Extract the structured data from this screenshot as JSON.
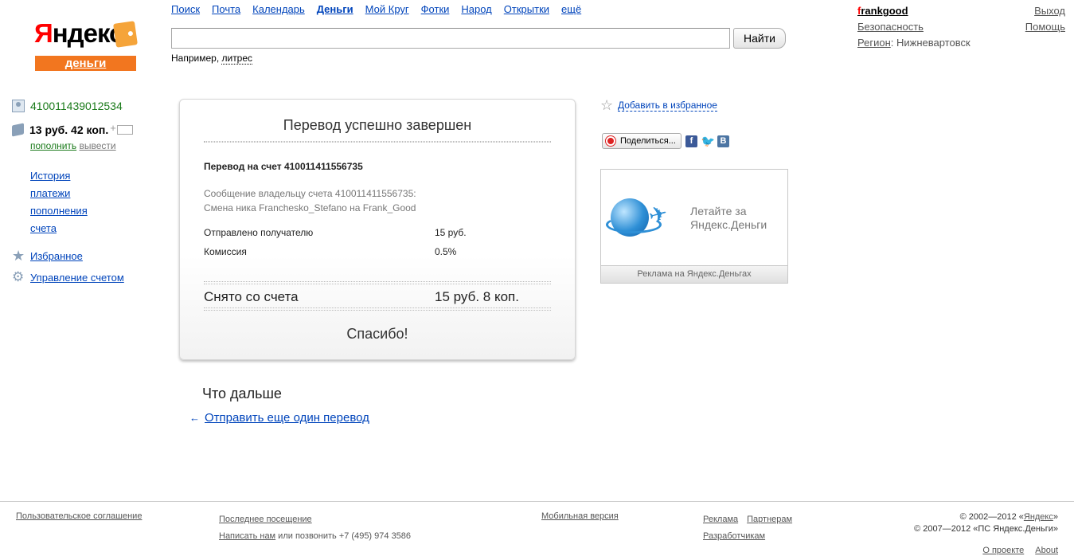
{
  "logo": {
    "word_first": "Я",
    "word_rest": "ндекс",
    "service": "деньги"
  },
  "topnav": {
    "items": [
      "Поиск",
      "Почта",
      "Календарь",
      "Деньги",
      "Мой Круг",
      "Фотки",
      "Народ",
      "Открытки",
      "ещё"
    ],
    "active": "Деньги"
  },
  "search": {
    "value": "",
    "button": "Найти",
    "example_prefix": "Например, ",
    "example_link": "литрес"
  },
  "user": {
    "name_first": "f",
    "name_rest": "rankgood",
    "security": "Безопасность",
    "region_label": "Регион",
    "region_value": ": Нижневартовск",
    "logout": "Выход",
    "help": "Помощь"
  },
  "sidebar": {
    "account_number": "410011439012534",
    "balance": "13 руб. 42 коп.",
    "topup": "пополнить",
    "withdraw": "вывести",
    "menu": [
      "История",
      "платежи",
      "пополнения",
      "счета"
    ],
    "favorites": "Избранное",
    "manage": "Управление счетом"
  },
  "receipt": {
    "title": "Перевод успешно завершен",
    "to": "Перевод на счет 410011411556735",
    "message_line1": "Сообщение владельцу счета 410011411556735:",
    "message_line2": "Смена ника Franchesko_Stefano на Frank_Good",
    "sent_label": "Отправлено получателю",
    "sent_value": "15 руб.",
    "fee_label": "Комиссия",
    "fee_value": "0.5%",
    "total_label": "Снято со счета",
    "total_value": "15 руб. 8 коп.",
    "thanks": "Спасибо!"
  },
  "next": {
    "title": "Что дальше",
    "link": "Отправить еще один перевод"
  },
  "right": {
    "add_favorite": "Добавить в избранное",
    "share": "Поделиться...",
    "ad_line1": "Летайте за",
    "ad_line2": "Яндекс.Деньги",
    "ad_caption": "Реклама на Яндекс.Деньгах"
  },
  "footer": {
    "agreement": "Пользовательское соглашение",
    "last_visit": "Последнее посещение",
    "write_us": "Написать нам",
    "call_text": " или позвонить +7 (495) 974 3586",
    "mobile": "Мобильная версия",
    "ads": "Реклама",
    "partners": "Партнерам",
    "developers": "Разработчикам",
    "copyright1_prefix": "© 2002—2012 «",
    "copyright1_link": "Яндекс",
    "copyright1_suffix": "»",
    "copyright2": "© 2007—2012 «ПС Яндекс.Деньги»",
    "about_project": "О проекте",
    "about": "About"
  },
  "colors": {
    "link": "#0044bb",
    "logo_red": "#ff0000",
    "logo_orange": "#f2761f",
    "green": "#1a7a1a"
  }
}
